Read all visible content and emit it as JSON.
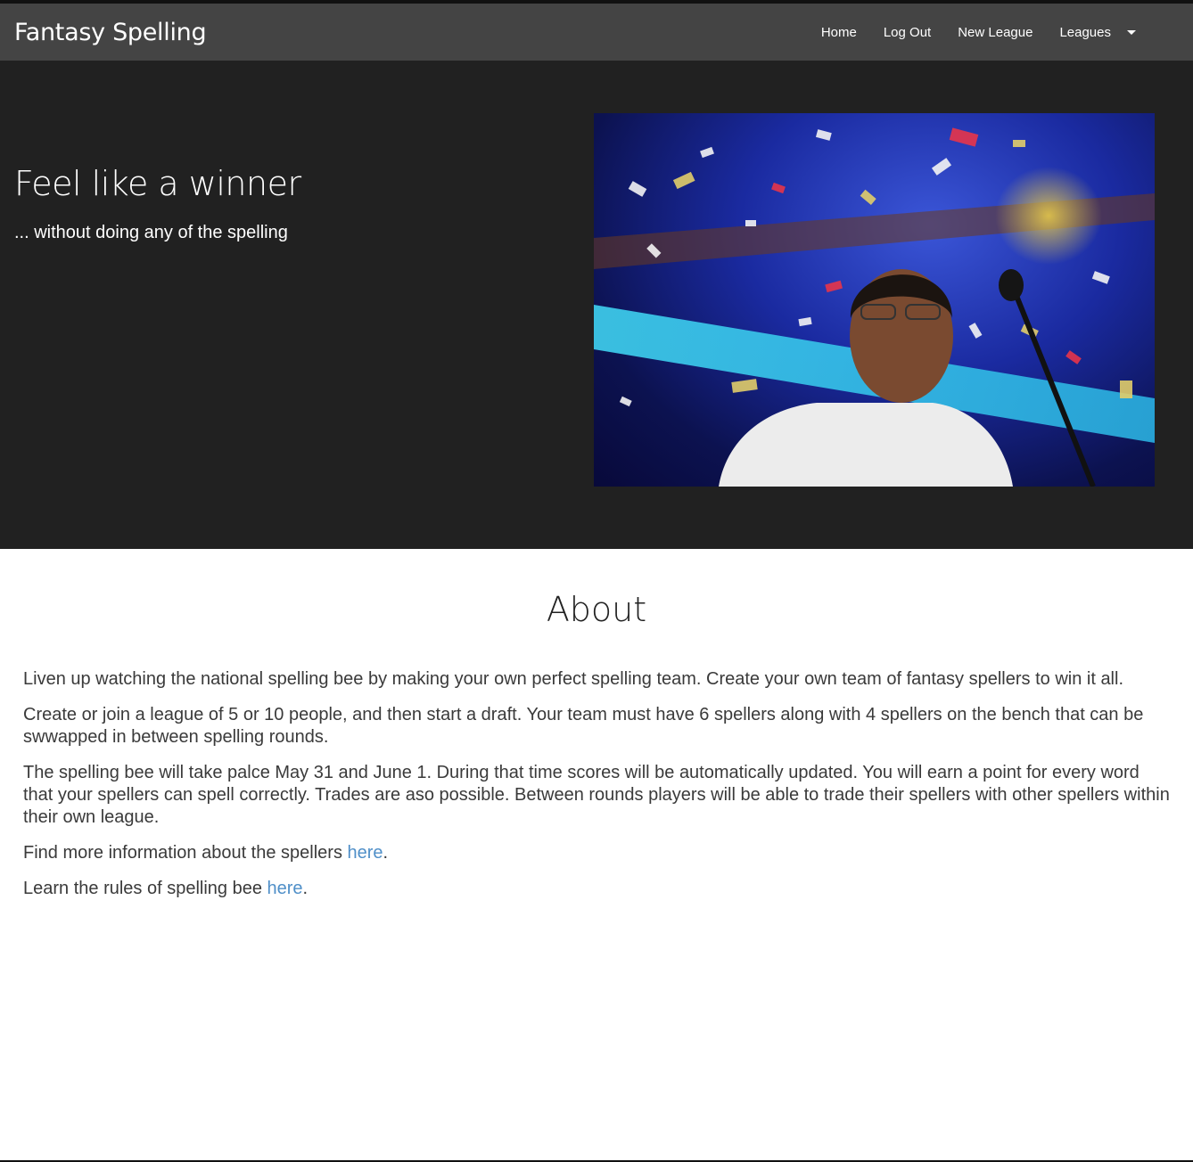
{
  "nav": {
    "brand": "Fantasy Spelling",
    "links": [
      "Home",
      "Log Out",
      "New League"
    ],
    "dropdown_label": "Leagues"
  },
  "hero": {
    "title": "Feel like a winner",
    "subtitle": "... without doing any of the spelling"
  },
  "about": {
    "title": "About",
    "p1": "Liven up watching the national spelling bee by making your own perfect spelling team. Create your own team of fantasy spellers to win it all.",
    "p2": "Create or join a league of 5 or 10 people, and then start a draft. Your team must have 6 spellers along with 4 spellers on the bench that can be swwapped in between spelling rounds.",
    "p3": "The spelling bee will take palce May 31 and June 1. During that time scores will be automatically updated. You will earn a point for every word that your spellers can spell correctly. Trades are aso possible. Between rounds players will be able to trade their spellers with other spellers within their own league.",
    "p4_text": "Find more information about the spellers ",
    "p4_link": "here",
    "p4_end": ".",
    "p5_text": "Learn the rules of spelling bee ",
    "p5_link": "here",
    "p5_end": "."
  },
  "colors": {
    "navbar": "#444444",
    "hero_bg": "#212121",
    "link": "#4f8fc8"
  }
}
